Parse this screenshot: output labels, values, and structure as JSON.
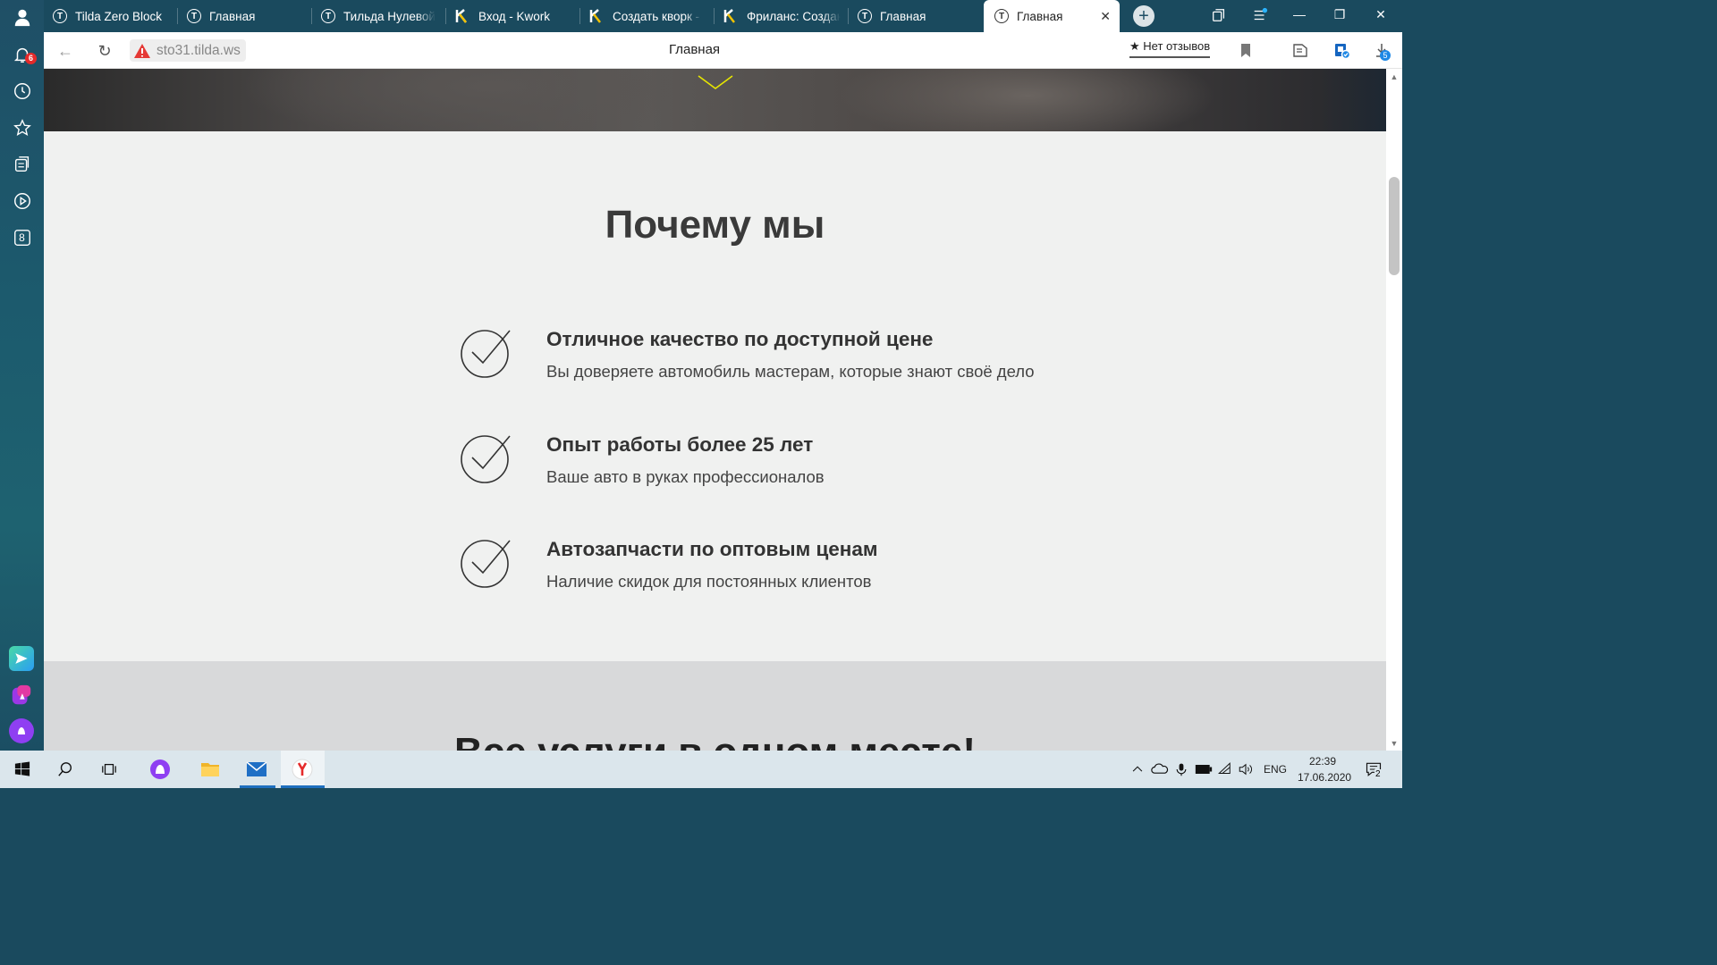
{
  "browser": {
    "tabs": [
      {
        "label": "Tilda Zero Block",
        "icon": "tilda-icon"
      },
      {
        "label": "Главная",
        "icon": "tilda-icon"
      },
      {
        "label": "Тильда Нулевой",
        "icon": "tilda-icon"
      },
      {
        "label": "Вход - Kwork",
        "icon": "kwork-icon"
      },
      {
        "label": "Создать кворк - Kwork",
        "icon": "kwork-icon"
      },
      {
        "label": "Фриланс: Создание",
        "icon": "kwork-icon"
      },
      {
        "label": "Главная",
        "icon": "tilda-icon"
      },
      {
        "label": "Главная",
        "icon": "tilda-icon",
        "active": true
      }
    ],
    "address": {
      "url": "sto31.tilda.ws",
      "page_title": "Главная",
      "reviews_label": "★ Нет отзывов"
    },
    "sidebar": {
      "notifications_count": "6",
      "collections_label": "8"
    },
    "downloads_count": "5"
  },
  "page": {
    "section_title": "Почему мы",
    "features": [
      {
        "title": "Отличное качество по доступной цене",
        "description": "Вы доверяете автомобиль мастерам, которые знают своё дело"
      },
      {
        "title": "Опыт работы более 25 лет",
        "description": "Ваше авто в руках профессионалов"
      },
      {
        "title": "Автозапчасти по оптовым ценам",
        "description": "Наличие скидок для постоянных клиентов"
      }
    ],
    "next_section_title": "Все услуги в одном месте!"
  },
  "taskbar": {
    "language": "ENG",
    "time": "22:39",
    "date": "17.06.2020",
    "notifications_count": "2"
  },
  "colors": {
    "accent_yellow": "#e6e600",
    "sidebar_bg": "#1f4f66",
    "content_bg": "#f0f1f0"
  }
}
